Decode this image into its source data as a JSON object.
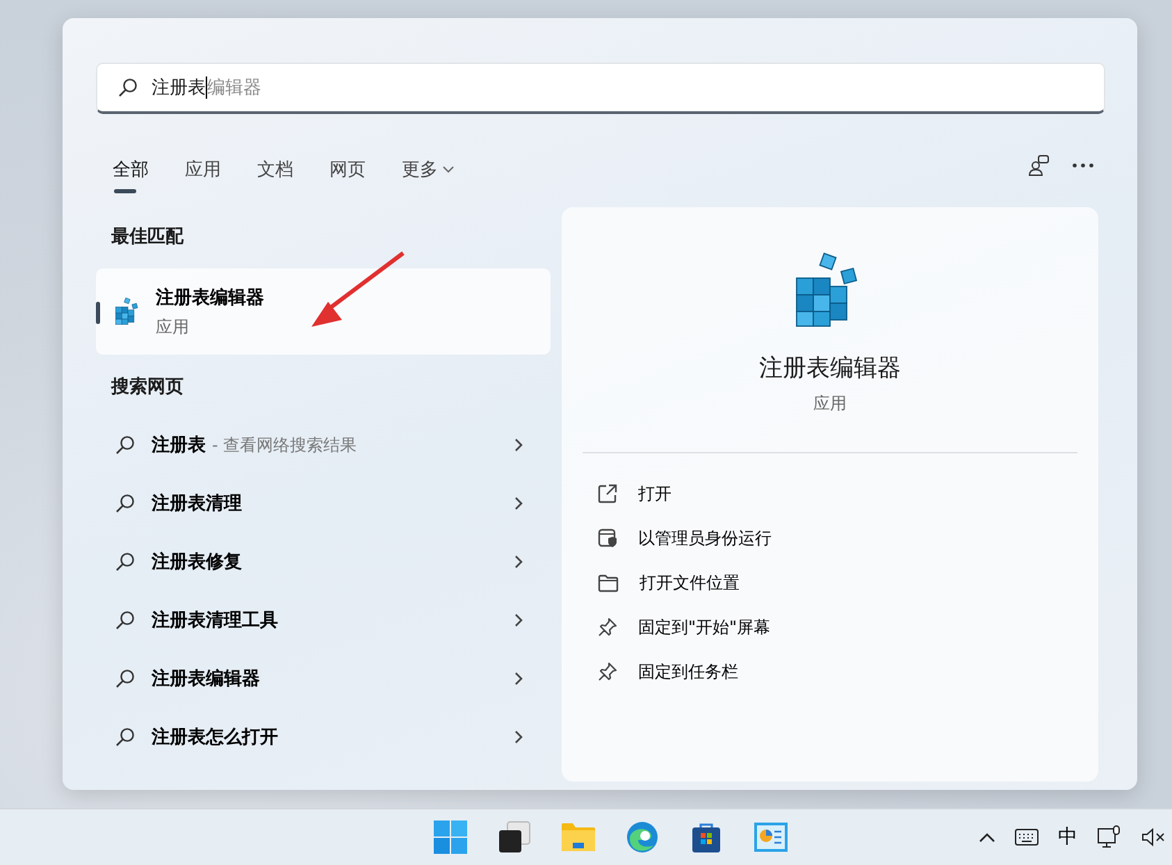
{
  "search": {
    "value": "注册表",
    "suggestion": "编辑器"
  },
  "tabs": [
    {
      "label": "全部",
      "selected": true,
      "kind": "tab"
    },
    {
      "label": "应用",
      "selected": false,
      "kind": "tab"
    },
    {
      "label": "文档",
      "selected": false,
      "kind": "tab"
    },
    {
      "label": "网页",
      "selected": false,
      "kind": "tab"
    },
    {
      "label": "更多",
      "selected": false,
      "kind": "dropdown"
    }
  ],
  "best_match": {
    "heading": "最佳匹配",
    "title": "注册表编辑器",
    "subtitle": "应用",
    "selected": true
  },
  "web": {
    "heading": "搜索网页",
    "items": [
      {
        "label": "注册表",
        "hint": "- 查看网络搜索结果"
      },
      {
        "label": "注册表清理"
      },
      {
        "label": "注册表修复"
      },
      {
        "label": "注册表清理工具"
      },
      {
        "label": "注册表编辑器"
      },
      {
        "label": "注册表怎么打开"
      }
    ]
  },
  "detail": {
    "title": "注册表编辑器",
    "subtitle": "应用",
    "actions": [
      {
        "label": "打开",
        "kind": "open"
      },
      {
        "label": "以管理员身份运行",
        "kind": "admin"
      },
      {
        "label": "打开文件位置",
        "kind": "folder"
      },
      {
        "label": "固定到\"开始\"屏幕",
        "kind": "pin"
      },
      {
        "label": "固定到任务栏",
        "kind": "pin"
      }
    ]
  },
  "taskbar": {
    "apps": [
      {
        "kind": "start"
      },
      {
        "kind": "taskview"
      },
      {
        "kind": "explorer"
      },
      {
        "kind": "edge"
      },
      {
        "kind": "store"
      },
      {
        "kind": "panel"
      }
    ],
    "ime": "中"
  }
}
